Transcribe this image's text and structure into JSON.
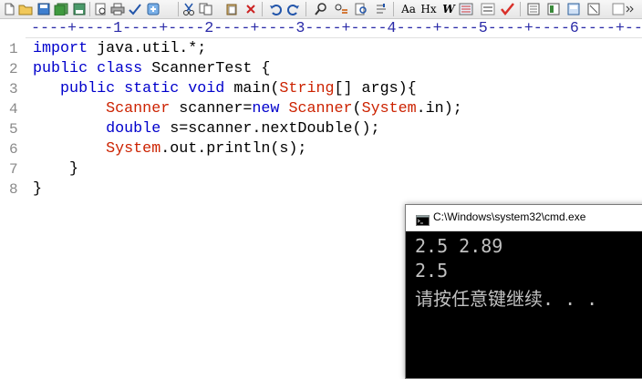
{
  "toolbar": {
    "icons": [
      "new-file",
      "open-folder",
      "save",
      "save-all",
      "print-preview",
      "print",
      "spell-check",
      "settings",
      "cut",
      "copy",
      "paste",
      "delete",
      "undo",
      "redo",
      "find",
      "replace",
      "find-in-files",
      "go-to",
      "font",
      "hex",
      "word-wrap",
      "line-numbers",
      "abc",
      "check",
      "window-a",
      "window-b",
      "window-c",
      "window-d"
    ],
    "text_items": [
      "Aa",
      "Hx",
      "W"
    ]
  },
  "ruler": {
    "text": "----+----1----+----2----+----3----+----4----+----5----+----6----+--"
  },
  "editor": {
    "line_numbers": [
      "1",
      "2",
      "3",
      "4",
      "5",
      "6",
      "7",
      "8"
    ],
    "lines": [
      [
        {
          "t": "import",
          "c": "kw"
        },
        {
          "t": " java.util.*;",
          "c": "tx"
        }
      ],
      [
        {
          "t": "public",
          "c": "kw"
        },
        {
          "t": " ",
          "c": "tx"
        },
        {
          "t": "class",
          "c": "kw"
        },
        {
          "t": " ScannerTest {",
          "c": "tx"
        }
      ],
      [
        {
          "t": "   ",
          "c": "tx"
        },
        {
          "t": "public",
          "c": "kw"
        },
        {
          "t": " ",
          "c": "tx"
        },
        {
          "t": "static",
          "c": "kw"
        },
        {
          "t": " ",
          "c": "tx"
        },
        {
          "t": "void",
          "c": "kw"
        },
        {
          "t": " main(",
          "c": "tx"
        },
        {
          "t": "String",
          "c": "ty"
        },
        {
          "t": "[] args){",
          "c": "tx"
        }
      ],
      [
        {
          "t": "        ",
          "c": "tx"
        },
        {
          "t": "Scanner",
          "c": "ty"
        },
        {
          "t": " scanner=",
          "c": "tx"
        },
        {
          "t": "new",
          "c": "kw"
        },
        {
          "t": " ",
          "c": "tx"
        },
        {
          "t": "Scanner",
          "c": "ty"
        },
        {
          "t": "(",
          "c": "tx"
        },
        {
          "t": "System",
          "c": "ty"
        },
        {
          "t": ".in);",
          "c": "tx"
        }
      ],
      [
        {
          "t": "        ",
          "c": "tx"
        },
        {
          "t": "double",
          "c": "kw"
        },
        {
          "t": " s=scanner.nextDouble();",
          "c": "tx"
        }
      ],
      [
        {
          "t": "        ",
          "c": "tx"
        },
        {
          "t": "System",
          "c": "ty"
        },
        {
          "t": ".out.println(s);",
          "c": "tx"
        }
      ],
      [
        {
          "t": "    }",
          "c": "tx"
        }
      ],
      [
        {
          "t": "}",
          "c": "tx"
        }
      ]
    ]
  },
  "console": {
    "title": "C:\\Windows\\system32\\cmd.exe",
    "lines": [
      "2.5 2.89",
      "2.5",
      "请按任意键继续. . ."
    ]
  },
  "colors": {
    "keyword": "#0000cc",
    "type": "#cc2200",
    "text": "#000000",
    "line_number": "#8a8a8a",
    "ruler": "#2a2aa8",
    "console_bg": "#000000",
    "console_text": "#c0c0c0"
  }
}
